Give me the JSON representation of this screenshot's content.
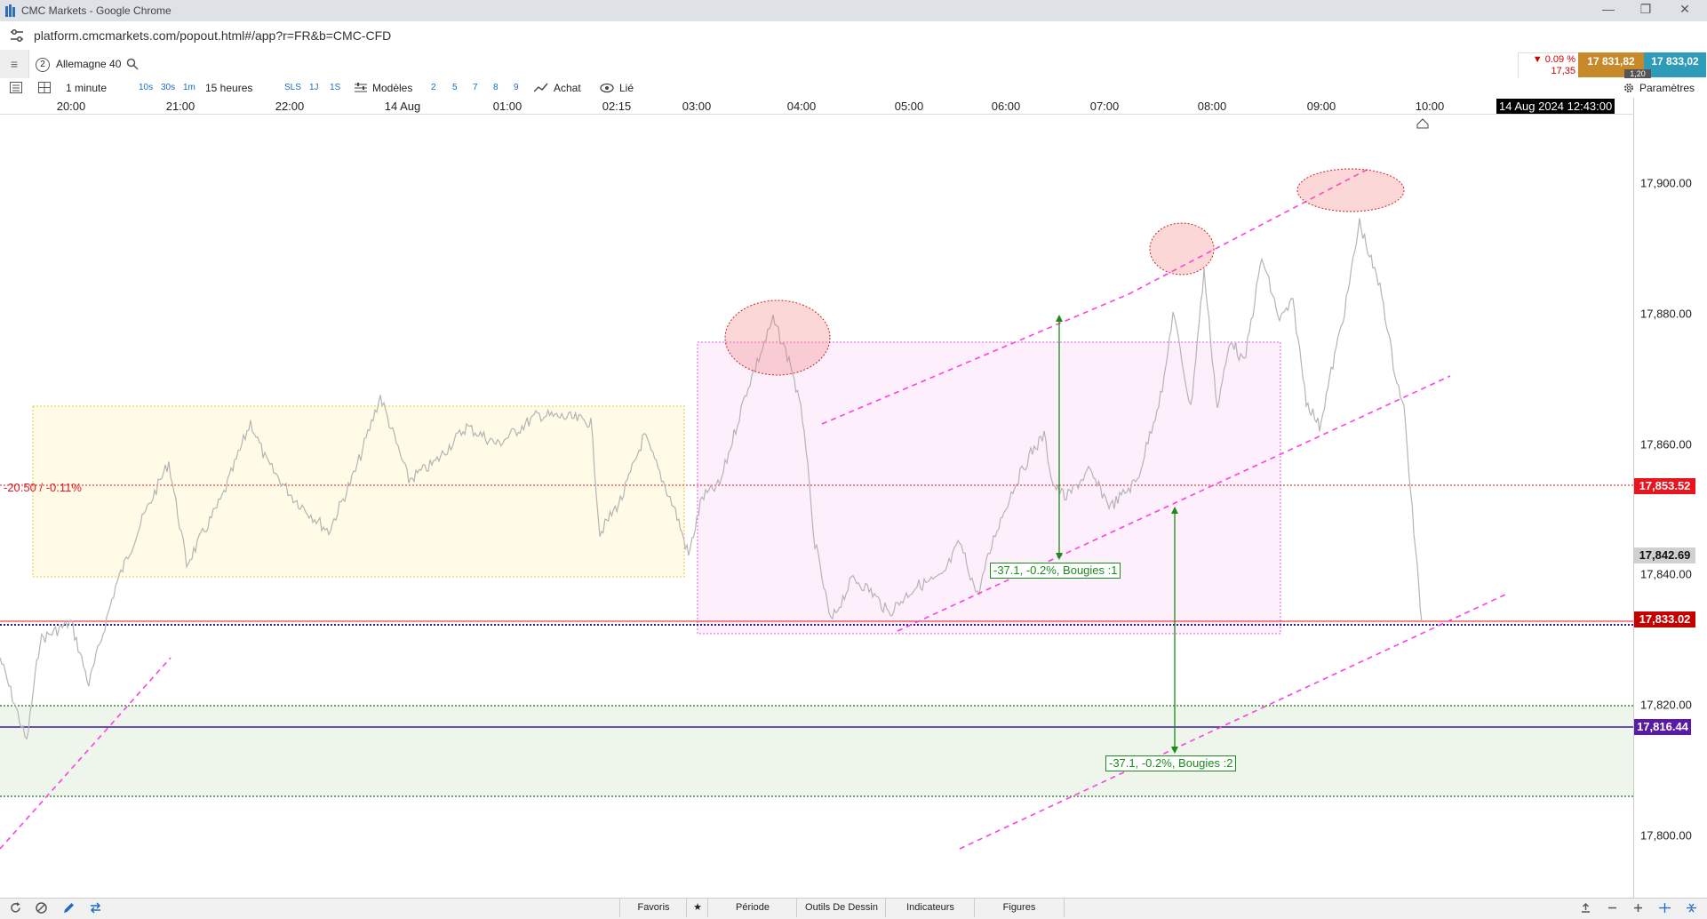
{
  "window": {
    "title": "CMC Markets - Google Chrome",
    "minimize": "—",
    "restore": "❐",
    "close": "✕"
  },
  "browser": {
    "url": "platform.cmcmarkets.com/popout.html#/app?r=FR&b=CMC-CFD"
  },
  "instrument": {
    "menu_icon": "≡",
    "badge": "2",
    "name": "Allemagne 40",
    "change_pct": "▼ 0.09 %",
    "change_pts": "17,35",
    "sell_price": "17 831,82",
    "buy_price": "17 833,02",
    "spread": "1,20",
    "colors": {
      "sell": "#c8892a",
      "buy": "#2e9cb8",
      "down": "#cc0000"
    }
  },
  "toolbar": {
    "interval": "1 minute",
    "intervals": [
      "10s",
      "30s",
      "1m"
    ],
    "period": "15 heures",
    "quick": [
      "SLS",
      "1J",
      "1S"
    ],
    "templates": "Modèles",
    "numbers": [
      "2",
      "5",
      "7",
      "8",
      "9"
    ],
    "buy": "Achat",
    "linked": "Lié",
    "settings": "Paramètres"
  },
  "time_axis": {
    "labels": [
      "20:00",
      "21:00",
      "22:00",
      "14 Aug",
      "01:00",
      "02:15",
      "03:00",
      "04:00",
      "05:00",
      "06:00",
      "07:00",
      "08:00",
      "09:00",
      "10:00"
    ],
    "cursor_time": "14 Aug 2024 12:43:00"
  },
  "price_axis": {
    "labels": [
      "17,900.00",
      "17,880.00",
      "17,860.00",
      "17,840.00",
      "17,820.00",
      "17,800.00"
    ],
    "badges": {
      "ref": {
        "text": "17,853.52",
        "color": "#e8141e"
      },
      "cursor": {
        "text": "17,842.69",
        "color": "#d0d0d0"
      },
      "last": {
        "text": "17,833.02",
        "color": "#c40000"
      },
      "line": {
        "text": "17,816.44",
        "color": "#5a1aa8"
      }
    }
  },
  "chart": {
    "reference_label": "-20.50 / -0.11%",
    "annotation_1": "-37.1, -0.2%, Bougies :1",
    "annotation_2": "-37.1, -0.2%, Bougies :2",
    "line_color": "#b4b4b4",
    "trend_color": "#ff3ee8"
  },
  "bottom": {
    "tabs": [
      "Favoris",
      "Période",
      "Outils De Dessin",
      "Indicateurs",
      "Figures"
    ],
    "star": "★"
  }
}
